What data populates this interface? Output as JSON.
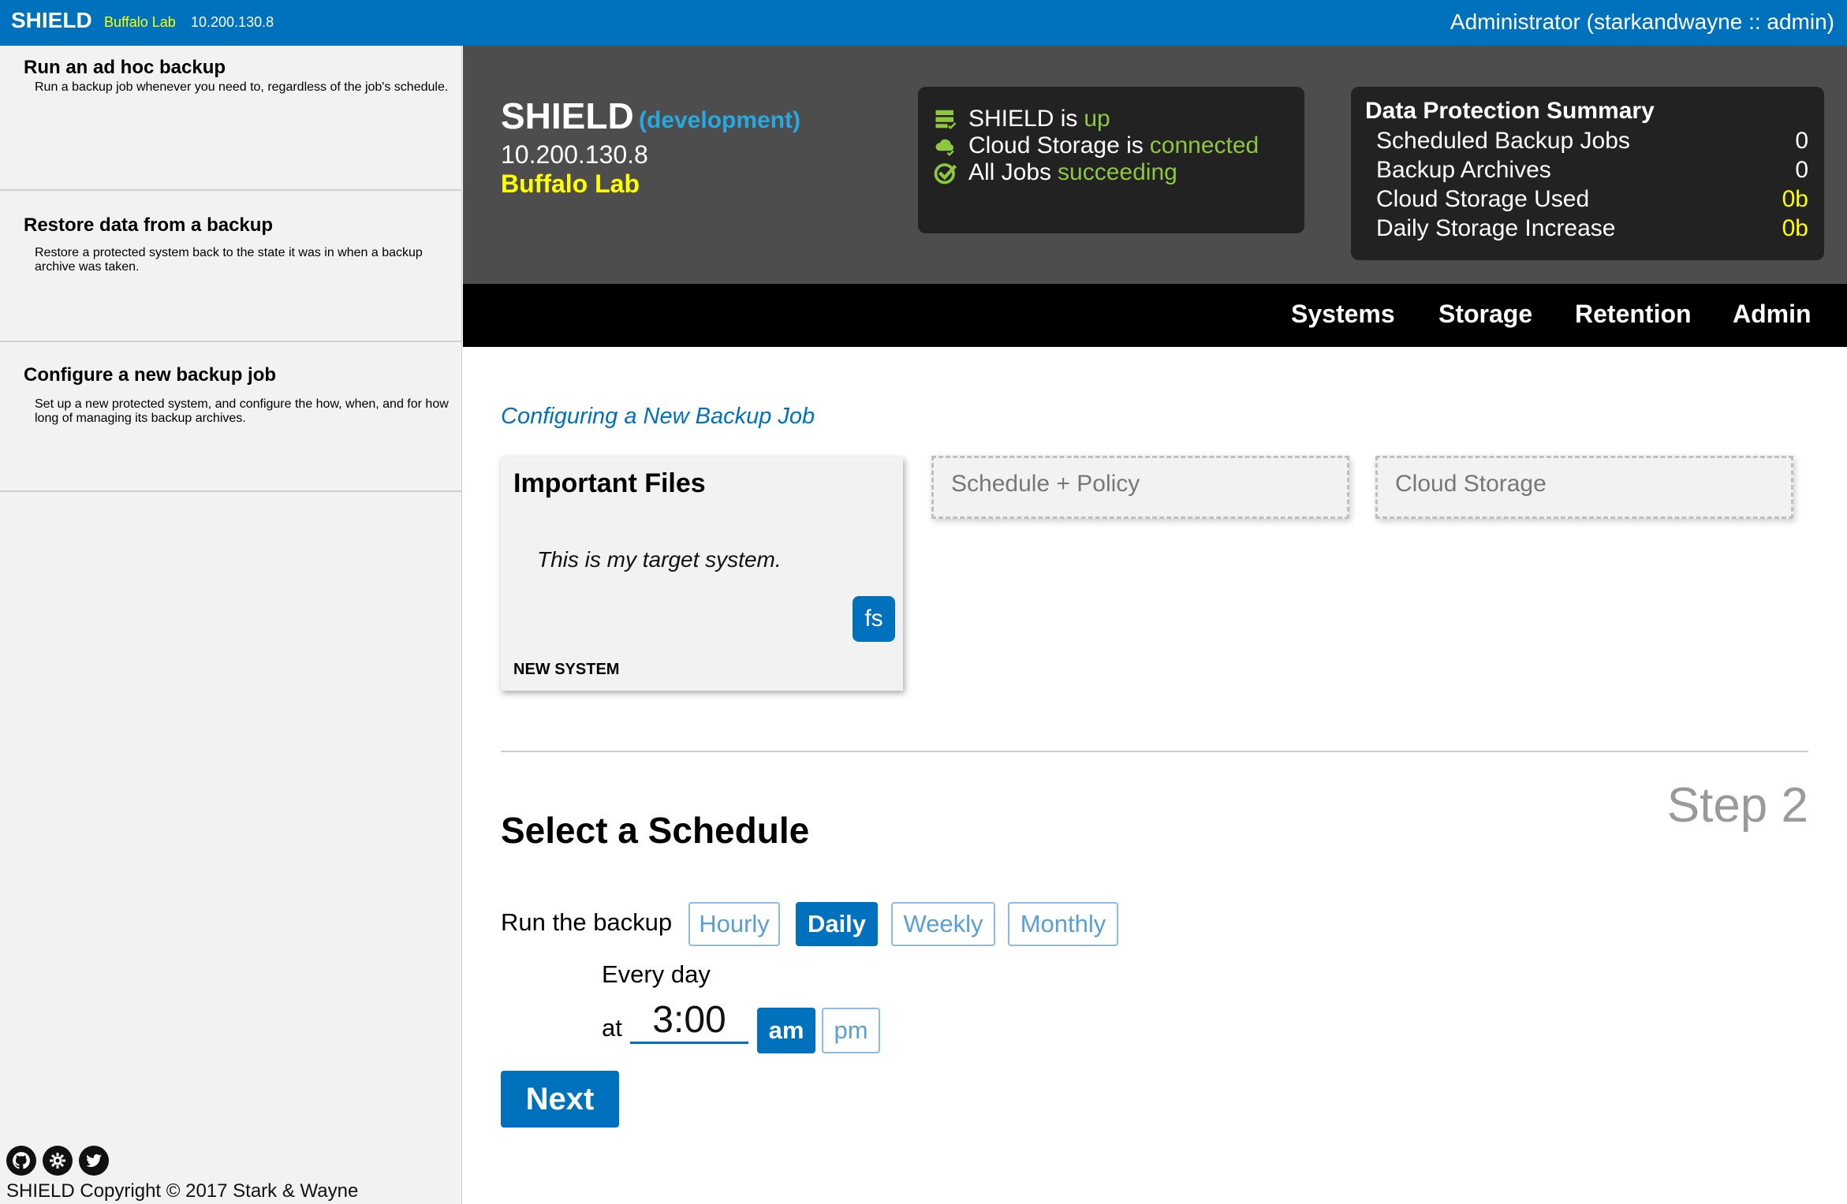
{
  "topbar": {
    "brand": "SHIELD",
    "env": "Buffalo Lab",
    "ip": "10.200.130.8",
    "user": "Administrator (starkandwayne :: admin)"
  },
  "sidebar": {
    "items": [
      {
        "title": "Run an ad hoc backup",
        "desc": "Run a backup job whenever you need to, regardless of the job's schedule."
      },
      {
        "title": "Restore data from a backup",
        "desc": "Restore a protected system back to the state it was in when a backup archive was taken."
      },
      {
        "title": "Configure a new backup job",
        "desc": "Set up a new protected system, and configure the how, when, and for how long of managing its backup archives."
      }
    ],
    "footer": {
      "icons": [
        "github-icon",
        "settings-icon",
        "twitter-icon"
      ],
      "copyright": "SHIELD Copyright © 2017 Stark & Wayne"
    }
  },
  "header": {
    "title": "SHIELD",
    "env": "(development)",
    "ip": "10.200.130.8",
    "name": "Buffalo Lab",
    "status": [
      {
        "icon": "server-icon",
        "text": "SHIELD is",
        "value": "up"
      },
      {
        "icon": "cloud-icon",
        "text": "Cloud Storage is",
        "value": "connected"
      },
      {
        "icon": "check-icon",
        "text": "All Jobs",
        "value": "succeeding"
      }
    ],
    "summary": {
      "title": "Data Protection Summary",
      "rows": [
        {
          "label": "Scheduled Backup Jobs",
          "value": "0"
        },
        {
          "label": "Backup Archives",
          "value": "0"
        },
        {
          "label": "Cloud Storage Used",
          "value": "0b"
        },
        {
          "label": "Daily Storage Increase",
          "value": "0b"
        }
      ]
    }
  },
  "nav": {
    "items": [
      "Systems",
      "Storage",
      "Retention",
      "Admin"
    ]
  },
  "main": {
    "breadcrumb": "Configuring a New Backup Job",
    "card": {
      "title": "Important Files",
      "desc": "This is my target system.",
      "badge": "fs",
      "footer": "NEW SYSTEM"
    },
    "placeholders": [
      "Schedule + Policy",
      "Cloud Storage"
    ],
    "step": "Step 2",
    "section_title": "Select a Schedule",
    "run_label": "Run the backup",
    "frequencies": [
      "Hourly",
      "Daily",
      "Weekly",
      "Monthly"
    ],
    "selected_frequency": "Daily",
    "every": "Every day",
    "at": "at",
    "time": "3:00",
    "ampm": [
      "am",
      "pm"
    ],
    "selected_ampm": "am",
    "next": "Next"
  },
  "colors": {
    "brand_blue": "#0071bc",
    "status_green": "#8dc63f",
    "highlight_yellow": "#ffff00",
    "header_gray": "#4d4d4d"
  }
}
